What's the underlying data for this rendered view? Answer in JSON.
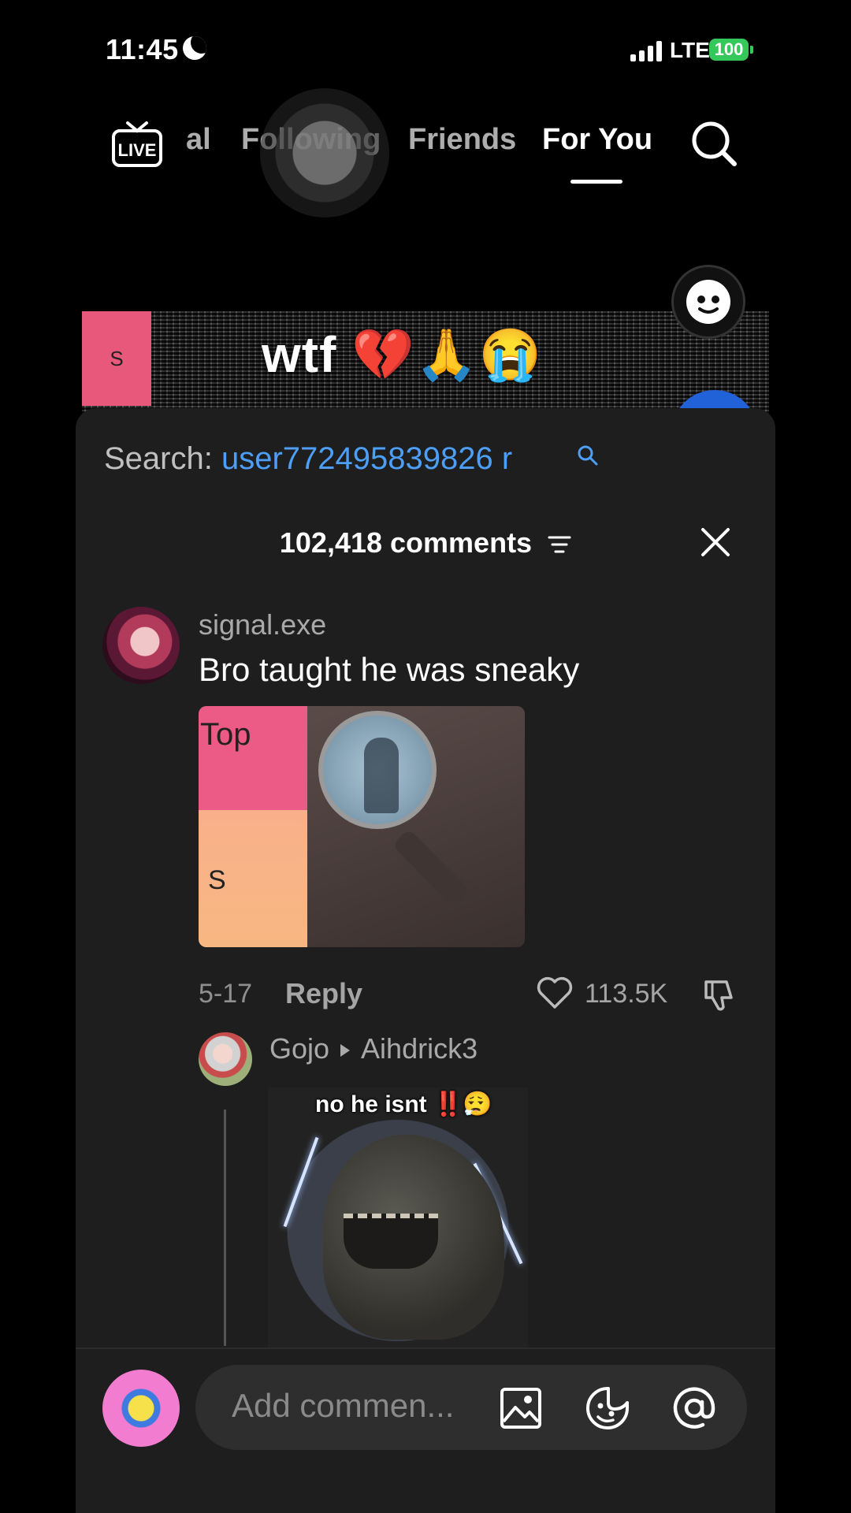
{
  "status_bar": {
    "time": "11:45",
    "network": "LTE",
    "battery": "100"
  },
  "top_nav": {
    "tabs": [
      {
        "label": "al",
        "active": false
      },
      {
        "label": "Following",
        "active": false
      },
      {
        "label": "Friends",
        "active": false
      },
      {
        "label": "For You",
        "active": true
      }
    ]
  },
  "video": {
    "tier_label": "S",
    "overlay_text": "wtf 💔🙏😭"
  },
  "comments": {
    "search_label": "Search:",
    "search_query": "user772495839826 r",
    "count_text": "102,418 comments",
    "items": [
      {
        "username": "signal.exe",
        "text": "Bro taught he was sneaky",
        "image_tier_top": "Top",
        "image_tier_s": "S",
        "date": "5-17",
        "reply_label": "Reply",
        "likes": "113.5K"
      }
    ],
    "reply": {
      "username": "Gojo",
      "replying_to": "Aihdrick3",
      "image_caption": "no he isnt ‼️😮‍💨"
    }
  },
  "input": {
    "placeholder": "Add commen..."
  },
  "colors": {
    "accent_blue": "#4d9ef6",
    "battery_green": "#34c759",
    "sheet_bg": "#1e1e1e"
  }
}
